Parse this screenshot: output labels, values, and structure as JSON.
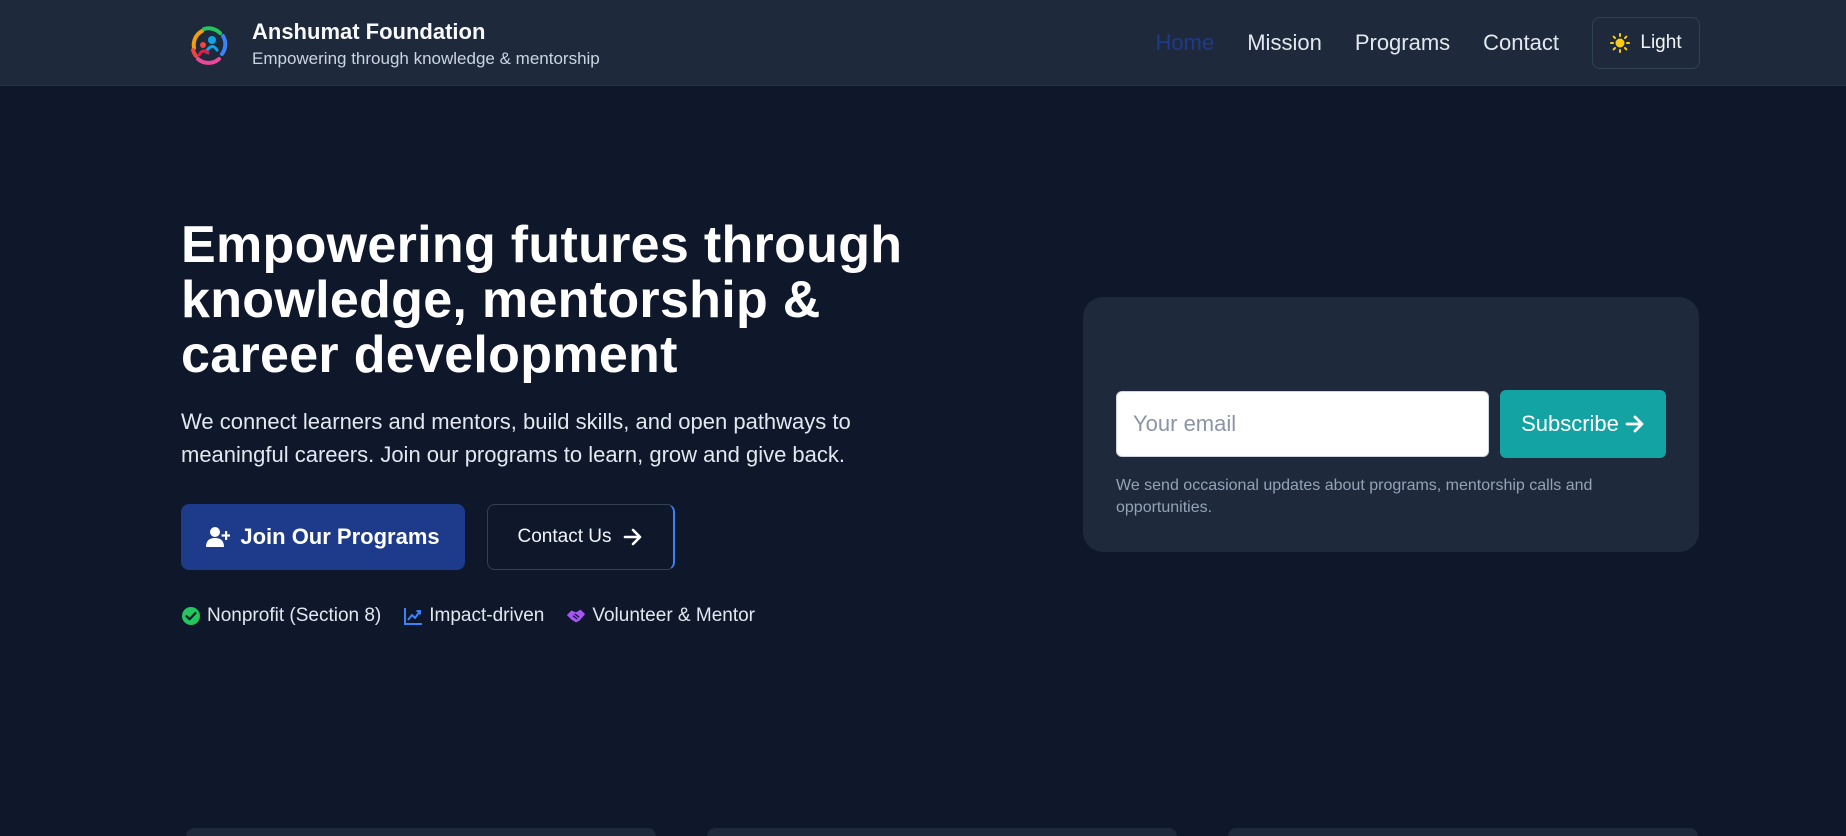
{
  "brand": {
    "name": "Anshumat Foundation",
    "tagline": "Empowering through knowledge & mentorship",
    "logo_icon": "people-circle-logo-icon"
  },
  "nav": {
    "items": [
      {
        "label": "Home",
        "active": true
      },
      {
        "label": "Mission",
        "active": false
      },
      {
        "label": "Programs",
        "active": false
      },
      {
        "label": "Contact",
        "active": false
      }
    ],
    "theme_toggle": {
      "label": "Light",
      "icon": "sun-icon"
    }
  },
  "hero": {
    "title": "Empowering futures through knowledge, mentorship & career development",
    "description": "We connect learners and mentors, build skills, and open pathways to meaningful careers. Join our programs to learn, grow and give back.",
    "primary_button": {
      "label": "Join Our Programs",
      "icon": "user-plus-icon"
    },
    "secondary_button": {
      "label": "Contact Us",
      "icon": "arrow-right-icon"
    },
    "badges": [
      {
        "label": "Nonprofit (Section 8)",
        "icon": "check-circle-icon",
        "color": "#22c55e"
      },
      {
        "label": "Impact-driven",
        "icon": "chart-line-icon",
        "color": "#3b82f6"
      },
      {
        "label": "Volunteer & Mentor",
        "icon": "handshake-icon",
        "color": "#a855f7"
      }
    ]
  },
  "subscribe": {
    "email_placeholder": "Your email",
    "button_label": "Subscribe",
    "button_icon": "arrow-right-icon",
    "note": "We send occasional updates about programs, mentorship calls and opportunities."
  },
  "colors": {
    "background": "#0f172a",
    "header": "#1e293b",
    "primary": "#1e3a8a",
    "accent": "#14a3a3",
    "theme_icon": "#facc15"
  }
}
